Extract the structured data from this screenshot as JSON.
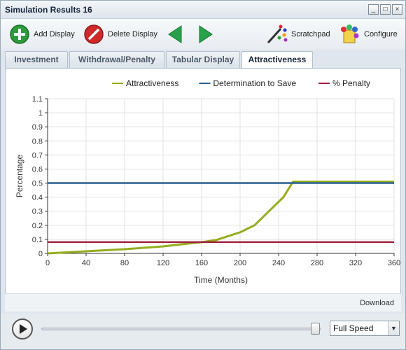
{
  "window": {
    "title": "Simulation Results 16",
    "controls": [
      "_",
      "□",
      "×"
    ]
  },
  "toolbar": {
    "add_label": "Add Display",
    "delete_label": "Delete Display",
    "scratchpad_label": "Scratchpad",
    "configure_label": "Configure"
  },
  "tabs": [
    {
      "label": "Investment"
    },
    {
      "label": "Withdrawal/Penalty"
    },
    {
      "label": "Tabular Display"
    },
    {
      "label": "Attractiveness",
      "active": true
    }
  ],
  "footer": {
    "download_label": "Download"
  },
  "playback": {
    "speed": "Full Speed",
    "progress": 0.98
  },
  "chart_data": {
    "type": "line",
    "xlabel": "Time (Months)",
    "ylabel": "Percentage",
    "xlim": [
      0,
      360
    ],
    "ylim": [
      0,
      1.1
    ],
    "xticks": [
      0,
      40,
      80,
      120,
      160,
      200,
      240,
      280,
      320,
      360
    ],
    "yticks": [
      0,
      0.1,
      0.2,
      0.3,
      0.4,
      0.5,
      0.6,
      0.7,
      0.8,
      0.9,
      1,
      1.1
    ],
    "grid": true,
    "legend_position": "top",
    "series": [
      {
        "name": "Attractiveness",
        "color": "#94ad1e",
        "x": [
          0,
          40,
          80,
          120,
          160,
          175,
          200,
          215,
          230,
          245,
          255,
          360
        ],
        "y": [
          0.0,
          0.015,
          0.03,
          0.05,
          0.08,
          0.095,
          0.15,
          0.2,
          0.3,
          0.4,
          0.51,
          0.51
        ]
      },
      {
        "name": "Determination to Save",
        "color": "#2a5e93",
        "x": [
          0,
          360
        ],
        "y": [
          0.5,
          0.5
        ]
      },
      {
        "name": "% Penalty",
        "color": "#a0223c",
        "x": [
          0,
          360
        ],
        "y": [
          0.08,
          0.08
        ]
      }
    ]
  }
}
